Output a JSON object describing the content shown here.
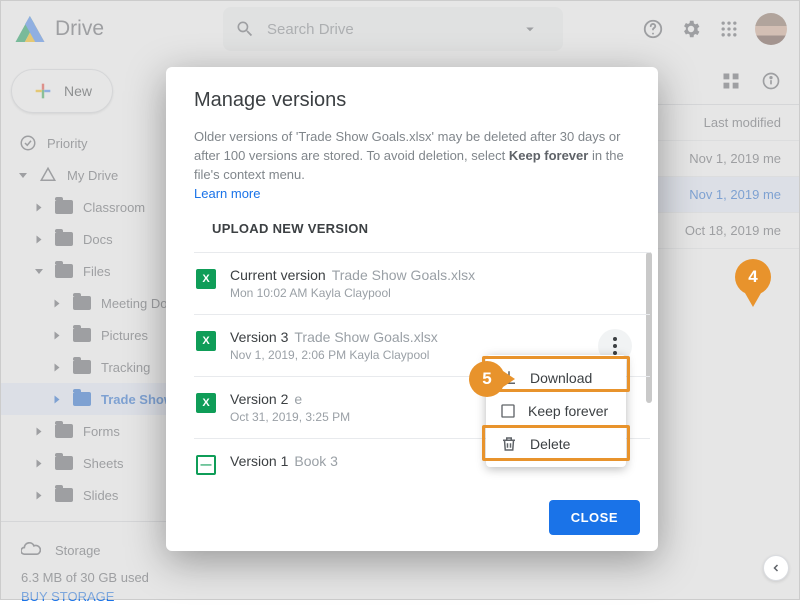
{
  "header": {
    "app_name": "Drive",
    "search_placeholder": "Search Drive"
  },
  "sidebar": {
    "new_label": "New",
    "priority": "Priority",
    "mydrive": "My Drive",
    "tree": {
      "classroom": "Classroom",
      "docs": "Docs",
      "files": "Files",
      "meeting": "Meeting Do",
      "pictures": "Pictures",
      "tracking": "Tracking",
      "tradeshow": "Trade Show",
      "forms": "Forms",
      "sheets": "Sheets",
      "slides": "Slides"
    },
    "storage_label": "Storage",
    "storage_used": "6.3 MB of 30 GB used",
    "buy": "BUY STORAGE"
  },
  "filelist": {
    "col_modified": "Last modified",
    "rows": [
      {
        "date": "Nov 1, 2019",
        "who": "me"
      },
      {
        "date": "Nov 1, 2019",
        "who": "me"
      },
      {
        "date": "Oct 18, 2019",
        "who": "me"
      }
    ]
  },
  "dialog": {
    "title": "Manage versions",
    "desc_prefix": "Older versions of 'Trade Show Goals.xlsx' may be deleted after 30 days or after 100 versions are stored. To avoid deletion, select ",
    "desc_bold": "Keep forever",
    "desc_suffix": " in the file's context menu.",
    "learn": "Learn more",
    "upload": "UPLOAD NEW VERSION",
    "versions": [
      {
        "title": "Current version",
        "fname": "Trade Show Goals.xlsx",
        "sub": "Mon 10:02 AM",
        "author": "Kayla Claypool",
        "icon": "X"
      },
      {
        "title": "Version 3",
        "fname": "Trade Show Goals.xlsx",
        "sub": "Nov 1, 2019, 2:06 PM",
        "author": "Kayla Claypool",
        "icon": "X"
      },
      {
        "title": "Version 2",
        "fname": "e",
        "sub": "Oct 31, 2019, 3:25 PM",
        "author": "",
        "icon": "X"
      },
      {
        "title": "Version 1",
        "fname": "Book 3",
        "sub": "",
        "author": "",
        "icon": "—"
      }
    ],
    "close": "CLOSE"
  },
  "context_menu": {
    "download": "Download",
    "keep": "Keep forever",
    "delete": "Delete"
  },
  "callouts": {
    "c4": "4",
    "c5": "5"
  }
}
